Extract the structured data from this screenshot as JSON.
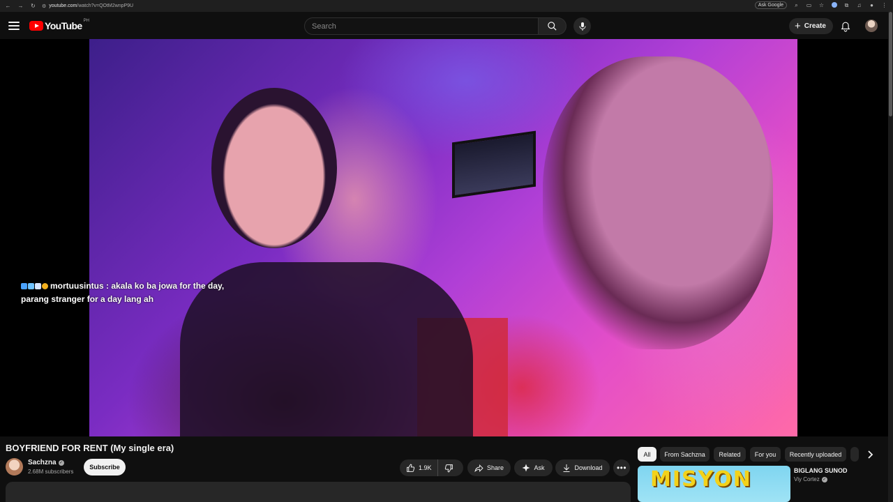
{
  "browser": {
    "url_host": "youtube.com",
    "url_path": "/watch?v=QOtM2wnpP9U",
    "ask_google": "Ask Google"
  },
  "masthead": {
    "logo_text": "YouTube",
    "region": "PH",
    "search_placeholder": "Search",
    "create_label": "Create"
  },
  "player": {
    "caption_user": "mortuusintus",
    "caption_text": ": akala ko ba jowa for the day, parang stranger for a day lang ah"
  },
  "video": {
    "title": "BOYFRIEND FOR RENT (My single era)",
    "channel": "Sachzna",
    "subscribers": "2.68M subscribers",
    "subscribe_label": "Subscribe",
    "likes": "1.9K",
    "share_label": "Share",
    "ask_label": "Ask",
    "download_label": "Download"
  },
  "chips": [
    "All",
    "From Sachzna",
    "Related",
    "For you",
    "Recently uploaded"
  ],
  "recommendation": {
    "thumb_text": "MISYON",
    "title": "BIGLANG SUNOD",
    "channel": "Viy Cortez"
  },
  "colors": {
    "brand_red": "#ff0000",
    "background": "#0f0f0f",
    "pill_bg": "#272727"
  }
}
